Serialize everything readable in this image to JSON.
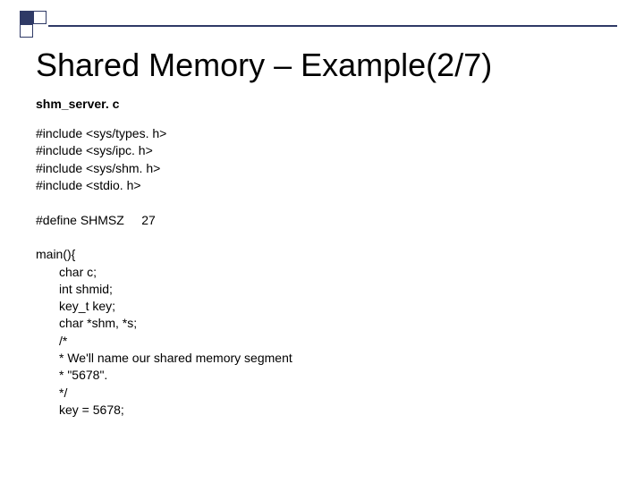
{
  "slide": {
    "title": "Shared Memory – Example(2/7)",
    "filename": "shm_server. c",
    "code": {
      "inc1": "#include <sys/types. h>",
      "inc2": "#include <sys/ipc. h>",
      "inc3": "#include <sys/shm. h>",
      "inc4": "#include <stdio. h>",
      "blank1": "",
      "define": "#define SHMSZ     27",
      "blank2": "",
      "main": "main(){",
      "l1": "char c;",
      "l2": "int shmid;",
      "l3": "key_t key;",
      "l4": "char *shm, *s;",
      "l5": "/*",
      "l6": "* We'll name our shared memory segment",
      "l7": "* \"5678\".",
      "l8": "*/",
      "l9": "key = 5678;"
    }
  }
}
